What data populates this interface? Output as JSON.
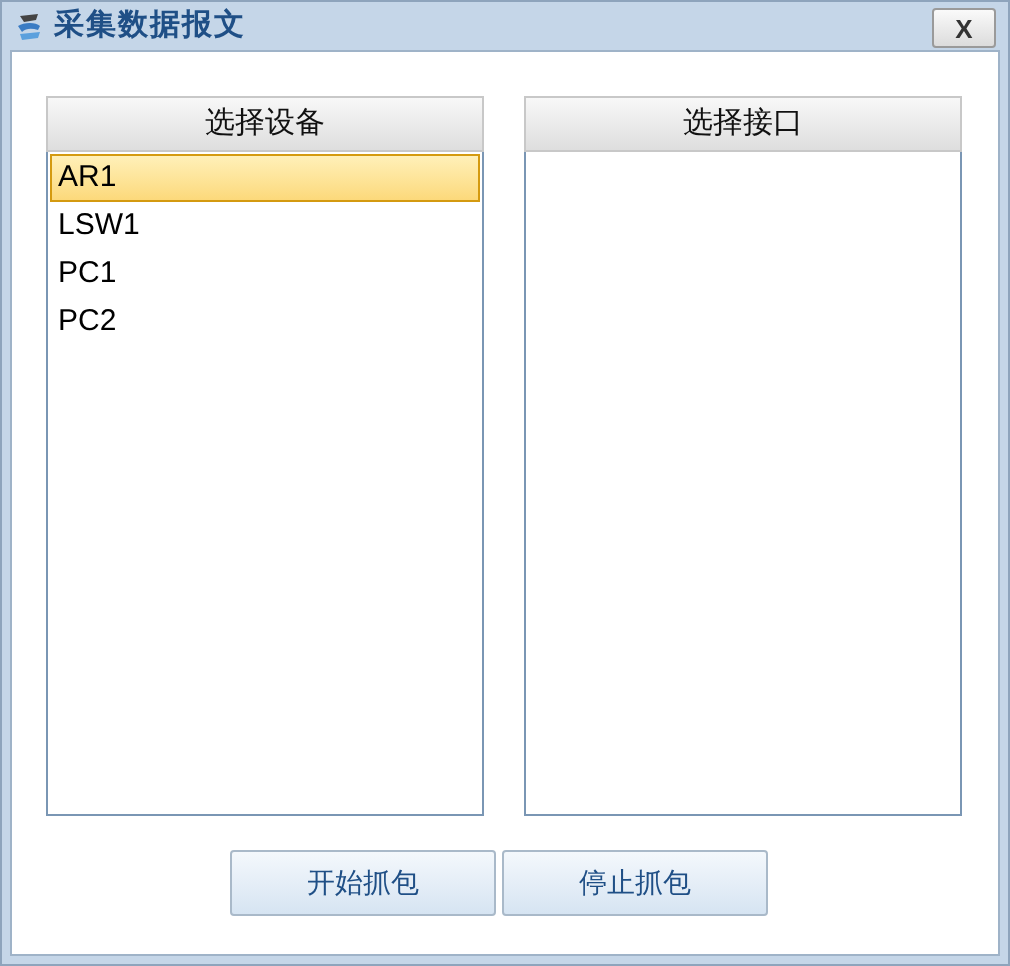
{
  "window": {
    "title": "采集数据报文",
    "close": "X"
  },
  "devices": {
    "header": "选择设备",
    "items": [
      {
        "label": "AR1",
        "selected": true
      },
      {
        "label": "LSW1",
        "selected": false
      },
      {
        "label": "PC1",
        "selected": false
      },
      {
        "label": "PC2",
        "selected": false
      }
    ]
  },
  "interfaces": {
    "header": "选择接口"
  },
  "buttons": [
    "开始抓包",
    "停止抓包"
  ]
}
